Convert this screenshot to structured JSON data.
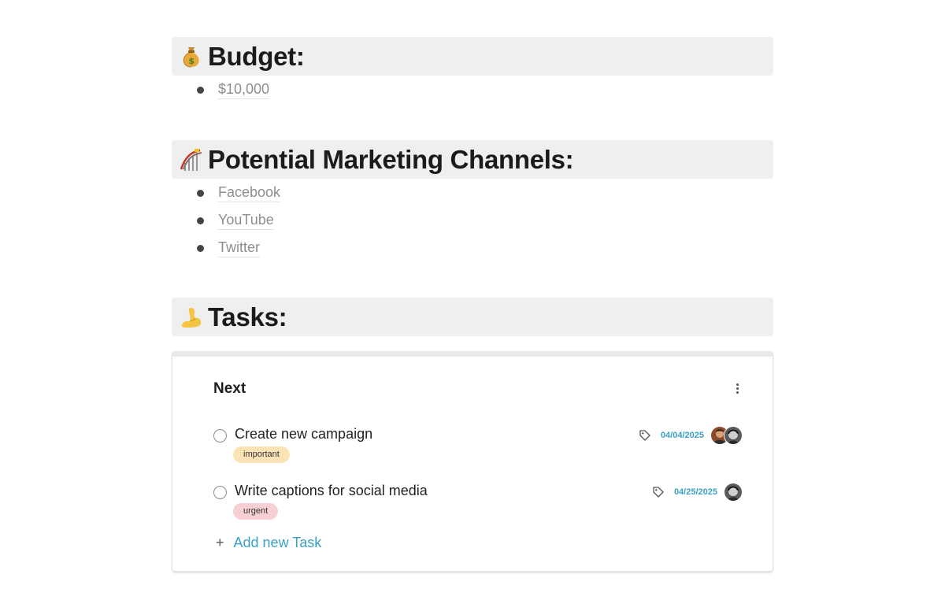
{
  "sections": {
    "budget": {
      "emoji": "money-bag",
      "title": "Budget:",
      "items": [
        "$10,000"
      ]
    },
    "channels": {
      "emoji": "rollercoaster",
      "title": "Potential Marketing Channels:",
      "items": [
        "Facebook",
        "YouTube",
        "Twitter"
      ]
    },
    "tasks": {
      "emoji": "flexed-biceps",
      "title": "Tasks:"
    }
  },
  "board": {
    "title": "Next",
    "tasks": [
      {
        "title": "Create new campaign",
        "date": "04/04/2025",
        "label": "important",
        "label_color": "#fbe3b6"
      },
      {
        "title": "Write captions for social media",
        "date": "04/25/2025",
        "label": "urgent",
        "label_color": "#f8cfd3"
      }
    ],
    "add_task": "Add new Task",
    "add_icon": "+"
  },
  "colors": {
    "accent": "#3aa0c4",
    "heading_bg": "#efefef"
  }
}
